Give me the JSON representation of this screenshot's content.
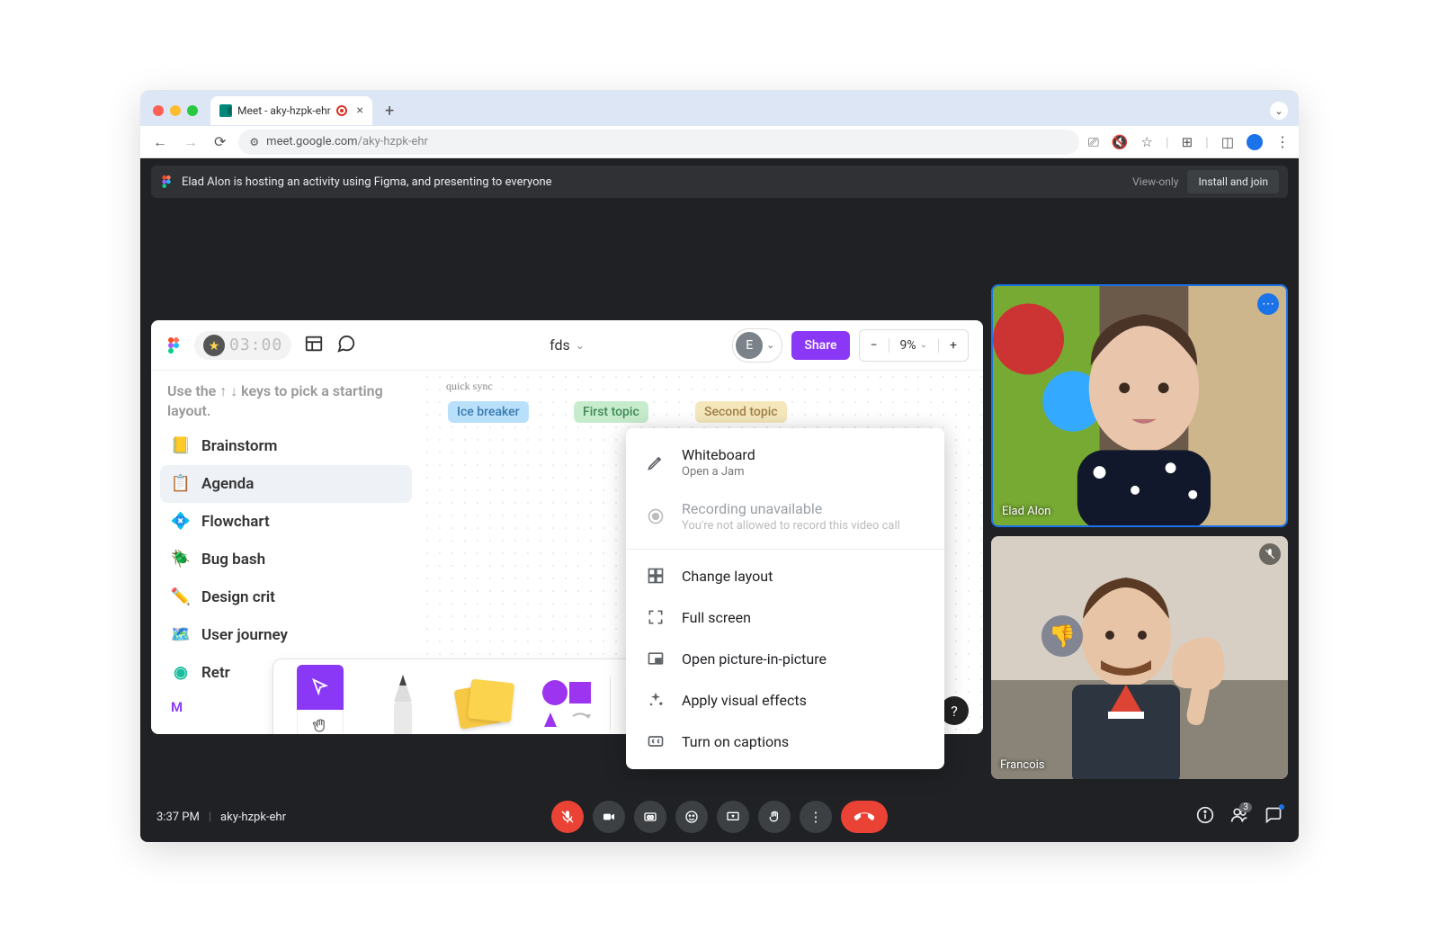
{
  "browser": {
    "tab_title": "Meet - aky-hzpk-ehr",
    "url_host": "meet.google.com",
    "url_path": "/aky-hzpk-ehr"
  },
  "banner": {
    "text": "Elad Alon is hosting an activity using Figma, and presenting to everyone",
    "view_only": "View-only",
    "install": "Install and join"
  },
  "figma": {
    "timer": "03:00",
    "doc_title": "fds",
    "avatar_letter": "E",
    "share": "Share",
    "zoom": "9%",
    "hint": "Use the ↑ ↓ keys to pick a starting layout.",
    "templates": [
      "Brainstorm",
      "Agenda",
      "Flowchart",
      "Bug bash",
      "Design crit",
      "User journey",
      "Retr"
    ],
    "selected_template_index": 1,
    "more": "M",
    "canvas": {
      "quick_sync": "quick sync",
      "pills": [
        "Ice breaker",
        "First topic",
        "Second topic"
      ]
    },
    "help": "?"
  },
  "popup": {
    "items": [
      {
        "icon": "pencil",
        "title": "Whiteboard",
        "subtitle": "Open a Jam",
        "disabled": false
      },
      {
        "icon": "record",
        "title": "Recording unavailable",
        "subtitle": "You're not allowed to record this video call",
        "disabled": true
      }
    ],
    "sep": true,
    "items2": [
      {
        "icon": "layout",
        "title": "Change layout"
      },
      {
        "icon": "fullscreen",
        "title": "Full screen"
      },
      {
        "icon": "pip",
        "title": "Open picture-in-picture"
      },
      {
        "icon": "sparkle",
        "title": "Apply visual effects"
      },
      {
        "icon": "cc",
        "title": "Turn on captions"
      }
    ]
  },
  "participants": [
    {
      "name": "Elad Alon",
      "active": true,
      "muted": false
    },
    {
      "name": "Francois",
      "active": false,
      "muted": true
    }
  ],
  "bottom": {
    "time": "3:37 PM",
    "code": "aky-hzpk-ehr",
    "participant_count": "3"
  }
}
